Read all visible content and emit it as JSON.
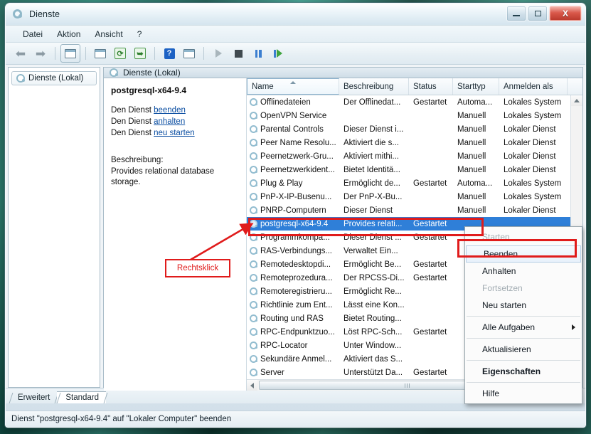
{
  "window": {
    "title": "Dienste",
    "icon": "services-gear-icon",
    "controls": {
      "minimize": "–",
      "maximize": "❐",
      "close": "X"
    }
  },
  "menubar": {
    "items": [
      "Datei",
      "Aktion",
      "Ansicht",
      "?"
    ]
  },
  "toolbar": {
    "items": [
      "back-arrow-icon",
      "forward-arrow-icon",
      "show-hide-tree-icon",
      "properties-icon",
      "refresh-icon",
      "export-list-icon",
      "help-icon",
      "show-action-pane-icon",
      "start-service-icon",
      "stop-service-icon",
      "pause-service-icon",
      "restart-service-icon"
    ]
  },
  "sidebar": {
    "items": [
      {
        "label": "Dienste (Lokal)",
        "icon": "services-gear-icon"
      }
    ]
  },
  "pane": {
    "header": "Dienste (Lokal)",
    "header_icon": "services-gear-icon"
  },
  "details": {
    "service_name": "postgresql-x64-9.4",
    "action_prefix": "Den Dienst ",
    "actions": [
      {
        "prefix": "Den Dienst ",
        "link": "beenden"
      },
      {
        "prefix": "Den Dienst ",
        "link": "anhalten"
      },
      {
        "prefix": "Den Dienst ",
        "link": "neu starten"
      }
    ],
    "description_label": "Beschreibung:",
    "description_text": "Provides relational database storage."
  },
  "list": {
    "columns": [
      {
        "key": "name",
        "label": "Name",
        "sorted": true
      },
      {
        "key": "desc",
        "label": "Beschreibung",
        "sorted": false
      },
      {
        "key": "status",
        "label": "Status",
        "sorted": false
      },
      {
        "key": "starttype",
        "label": "Starttyp",
        "sorted": false
      },
      {
        "key": "logon",
        "label": "Anmelden als",
        "sorted": false
      }
    ],
    "rows": [
      {
        "name": "Offlinedateien",
        "desc": "Der Offlinedat...",
        "status": "Gestartet",
        "starttype": "Automa...",
        "logon": "Lokales System",
        "selected": false
      },
      {
        "name": "OpenVPN Service",
        "desc": "",
        "status": "",
        "starttype": "Manuell",
        "logon": "Lokales System",
        "selected": false
      },
      {
        "name": "Parental Controls",
        "desc": "Dieser Dienst i...",
        "status": "",
        "starttype": "Manuell",
        "logon": "Lokaler Dienst",
        "selected": false
      },
      {
        "name": "Peer Name Resolu...",
        "desc": "Aktiviert die s...",
        "status": "",
        "starttype": "Manuell",
        "logon": "Lokaler Dienst",
        "selected": false
      },
      {
        "name": "Peernetzwerk-Gru...",
        "desc": "Aktiviert mithi...",
        "status": "",
        "starttype": "Manuell",
        "logon": "Lokaler Dienst",
        "selected": false
      },
      {
        "name": "Peernetzwerkident...",
        "desc": "Bietet Identitä...",
        "status": "",
        "starttype": "Manuell",
        "logon": "Lokaler Dienst",
        "selected": false
      },
      {
        "name": "Plug & Play",
        "desc": "Ermöglicht de...",
        "status": "Gestartet",
        "starttype": "Automa...",
        "logon": "Lokales System",
        "selected": false
      },
      {
        "name": "PnP-X-IP-Busenu...",
        "desc": "Der PnP-X-Bu...",
        "status": "",
        "starttype": "Manuell",
        "logon": "Lokales System",
        "selected": false
      },
      {
        "name": "PNRP-Computern",
        "desc": "Dieser Dienst",
        "status": "",
        "starttype": "Manuell",
        "logon": "Lokaler Dienst",
        "selected": false
      },
      {
        "name": "postgresql-x64-9.4",
        "desc": "Provides relati...",
        "status": "Gestartet",
        "starttype": "",
        "logon": "",
        "selected": true
      },
      {
        "name": "Programmkompa...",
        "desc": "Dieser Dienst ...",
        "status": "Gestartet",
        "starttype": "",
        "logon": "",
        "selected": false
      },
      {
        "name": "RAS-Verbindungs...",
        "desc": "Verwaltet Ein...",
        "status": "",
        "starttype": "",
        "logon": "",
        "selected": false
      },
      {
        "name": "Remotedesktopdi...",
        "desc": "Ermöglicht Be...",
        "status": "Gestartet",
        "starttype": "",
        "logon": "",
        "selected": false
      },
      {
        "name": "Remoteprozedura...",
        "desc": "Der RPCSS-Di...",
        "status": "Gestartet",
        "starttype": "",
        "logon": "",
        "selected": false
      },
      {
        "name": "Remoteregistrieru...",
        "desc": "Ermöglicht Re...",
        "status": "",
        "starttype": "",
        "logon": "",
        "selected": false
      },
      {
        "name": "Richtlinie zum Ent...",
        "desc": "Lässt eine Kon...",
        "status": "",
        "starttype": "",
        "logon": "",
        "selected": false
      },
      {
        "name": "Routing und RAS",
        "desc": "Bietet Routing...",
        "status": "",
        "starttype": "",
        "logon": "",
        "selected": false
      },
      {
        "name": "RPC-Endpunktzuo...",
        "desc": "Löst RPC-Sch...",
        "status": "Gestartet",
        "starttype": "",
        "logon": "",
        "selected": false
      },
      {
        "name": "RPC-Locator",
        "desc": "Unter Window...",
        "status": "",
        "starttype": "",
        "logon": "",
        "selected": false
      },
      {
        "name": "Sekundäre Anmel...",
        "desc": "Aktiviert das S...",
        "status": "",
        "starttype": "",
        "logon": "",
        "selected": false
      },
      {
        "name": "Server",
        "desc": "Unterstützt Da...",
        "status": "Gestartet",
        "starttype": "",
        "logon": "",
        "selected": false
      }
    ]
  },
  "context_menu": {
    "items": [
      {
        "label": "Starten",
        "disabled": true,
        "bold": false,
        "submenu": false,
        "highlighted": false
      },
      {
        "label": "Beenden",
        "disabled": false,
        "bold": false,
        "submenu": false,
        "highlighted": true
      },
      {
        "label": "Anhalten",
        "disabled": false,
        "bold": false,
        "submenu": false,
        "highlighted": false
      },
      {
        "label": "Fortsetzen",
        "disabled": true,
        "bold": false,
        "submenu": false,
        "highlighted": false
      },
      {
        "label": "Neu starten",
        "disabled": false,
        "bold": false,
        "submenu": false,
        "highlighted": false
      },
      {
        "separator": true
      },
      {
        "label": "Alle Aufgaben",
        "disabled": false,
        "bold": false,
        "submenu": true,
        "highlighted": false
      },
      {
        "separator": true
      },
      {
        "label": "Aktualisieren",
        "disabled": false,
        "bold": false,
        "submenu": false,
        "highlighted": false
      },
      {
        "separator": true
      },
      {
        "label": "Eigenschaften",
        "disabled": false,
        "bold": true,
        "submenu": false,
        "highlighted": false
      },
      {
        "separator": true
      },
      {
        "label": "Hilfe",
        "disabled": false,
        "bold": false,
        "submenu": false,
        "highlighted": false
      }
    ]
  },
  "tabs": [
    {
      "label": "Erweitert",
      "active": false
    },
    {
      "label": "Standard",
      "active": true
    }
  ],
  "statusbar": {
    "text": "Dienst \"postgresql-x64-9.4\" auf \"Lokaler Computer\" beenden"
  },
  "annotations": {
    "label": "Rechtsklick",
    "color": "#e01b1b"
  }
}
